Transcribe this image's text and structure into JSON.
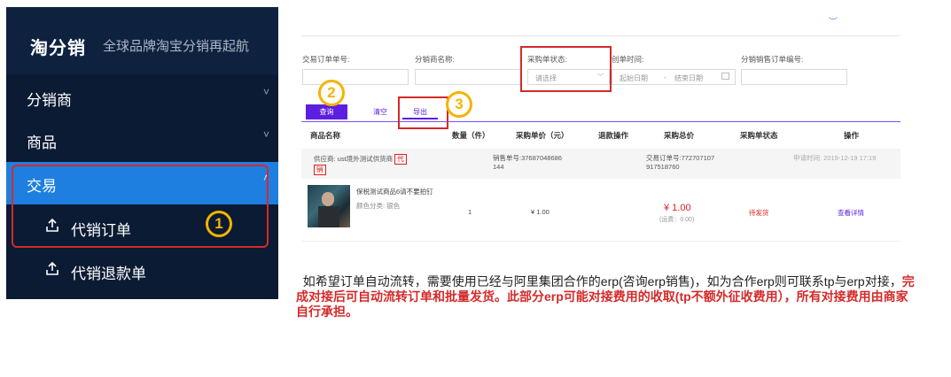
{
  "sidebar": {
    "logo": "淘分销",
    "slogan": "全球品牌淘宝分销再起航",
    "items": [
      {
        "label": "分销商",
        "chevron": "˅"
      },
      {
        "label": "商品",
        "chevron": "˅"
      },
      {
        "label": "交易",
        "chevron": "˄"
      }
    ],
    "subitems": [
      {
        "label": "代销订单",
        "icon": "upload-icon"
      },
      {
        "label": "代销退款单",
        "icon": "upload-icon"
      }
    ]
  },
  "form": {
    "top_icon": "︶",
    "fields": [
      {
        "label": "交易订单单号:",
        "placeholder": ""
      },
      {
        "label": "分销商名称:",
        "placeholder": ""
      },
      {
        "label": "采购单状态:",
        "placeholder": "请选择"
      },
      {
        "label": "创单时间:",
        "start_placeholder": "起始日期",
        "separator": "-",
        "end_placeholder": "结束日期"
      },
      {
        "label": "分销销售订单编号:",
        "placeholder": ""
      }
    ],
    "buttons": {
      "search": "查询",
      "clear": "清空",
      "export": "导出"
    }
  },
  "table": {
    "headers": [
      "商品名称",
      "数量（件）",
      "采购单价（元）",
      "退款操作",
      "采购总价",
      "采购单状态",
      "操作"
    ],
    "order": {
      "supplier_prefix": "供应商: ust境外测试供货商",
      "supplier_tag": "代",
      "supplier_tag_cont": "销",
      "sales_no_line1": "销售单号:37687048686",
      "sales_no_line2": "144",
      "trade_no_line1": "交易订单号:772707107",
      "trade_no_line2": "917518760",
      "apply_time": "申请时间: 2019-12-19 17:19"
    },
    "goods": {
      "name": "保税测试商品6请不要拍钉",
      "color": "颜色分类: 银色",
      "qty": "1",
      "unit_price": "¥ 1.00",
      "total": "¥ 1.00",
      "shipping": "(运费：0.00)",
      "status": "待发货",
      "action": "查看详情"
    }
  },
  "callouts": {
    "one": "1",
    "two": "2",
    "three": "3"
  },
  "description": {
    "part1": "如希望订单自动流转，需要使用已经与阿里集团合作的erp(咨询erp销售)，如为合作erp则可联系tp与erp对接，",
    "part2": "完成对接后可自动流转订单和批量发货。此部分erp可能对接费用的收取(tp不额外征收费用），所有对接费用由商家自行承担。"
  },
  "colors": {
    "sidebar_bg": "#0b1b33",
    "active": "#1e7fe0",
    "accent": "#5b1fe0",
    "highlight": "#d42a2a",
    "callout": "#f5b400"
  }
}
